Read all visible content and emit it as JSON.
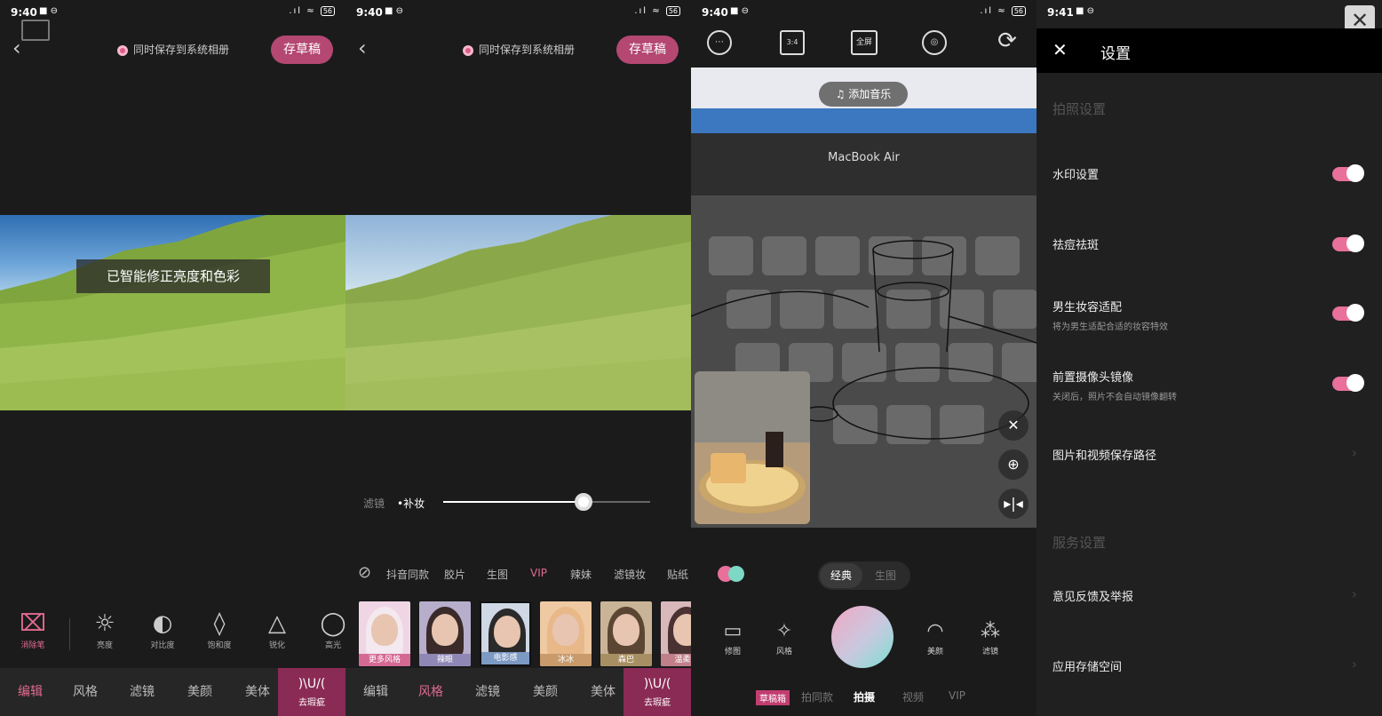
{
  "panel1": {
    "status": {
      "time": "9:40",
      "battery": "56"
    },
    "save_system": "同时保存到系统相册",
    "draft_button": "存草稿",
    "toast": "已智能修正亮度和色彩",
    "tools": [
      {
        "icon": "eraser-icon",
        "glyph": "⌧",
        "label": "消除笔",
        "active": true
      },
      {
        "icon": "brightness-icon",
        "glyph": "☼",
        "label": "亮度",
        "active": false
      },
      {
        "icon": "contrast-icon",
        "glyph": "◐",
        "label": "对比度",
        "active": false
      },
      {
        "icon": "saturation-icon",
        "glyph": "◊",
        "label": "饱和度",
        "active": false
      },
      {
        "icon": "sharpen-icon",
        "glyph": "△",
        "label": "锐化",
        "active": false
      },
      {
        "icon": "highlight-icon",
        "glyph": "◯",
        "label": "高光",
        "active": false
      }
    ],
    "tabs": [
      "编辑",
      "风格",
      "滤镜",
      "美颜",
      "美体"
    ],
    "tab_special": {
      "icon": ")\\U/(",
      "label": "去瑕疵"
    }
  },
  "panel2": {
    "status": {
      "time": "9:40",
      "battery": "56"
    },
    "save_system": "同时保存到系统相册",
    "draft_button": "存草稿",
    "filter_label": "滤镜",
    "filter_value": "•补妆",
    "slider_value": 0.68,
    "categories": [
      "抖音同款",
      "胶片",
      "生图",
      "VIP",
      "辣妹",
      "滤镜妆",
      "贴纸"
    ],
    "thumbs": [
      "更多风格",
      "辣眼",
      "电影感",
      "冰冰",
      "森巴",
      "温柔甜"
    ],
    "tabs": [
      "编辑",
      "风格",
      "滤镜",
      "美颜",
      "美体"
    ],
    "tab_special": {
      "icon": ")\\U/(",
      "label": "去瑕疵"
    }
  },
  "panel3": {
    "status": {
      "time": "9:40",
      "battery": "56"
    },
    "top_icons": [
      "⋯",
      "3:4",
      "全屏",
      "◎",
      "⟳"
    ],
    "music_button": "♫ 添加音乐",
    "laptop_label": "MacBook Air",
    "mode_classic": "经典",
    "mode_raw": "生图",
    "side_left": [
      {
        "label": "修图",
        "glyph": "▭"
      },
      {
        "label": "风格",
        "glyph": "✧"
      }
    ],
    "side_right": [
      {
        "label": "美颜",
        "glyph": "◠"
      },
      {
        "label": "滤镜",
        "glyph": "⁂"
      }
    ],
    "modes": [
      "草稿箱",
      "拍同款",
      "拍摄",
      "视频",
      "VIP"
    ],
    "current_mode": "拍摄"
  },
  "panel4": {
    "status": {
      "time": "9:41"
    },
    "title": "设置",
    "section_photo": "拍照设置",
    "rows": [
      {
        "title": "水印设置",
        "sub": "",
        "toggle": true
      },
      {
        "title": "祛痘祛斑",
        "sub": "",
        "toggle": true
      },
      {
        "title": "男生妆容适配",
        "sub": "将为男生适配合适的妆容特效",
        "toggle": true
      },
      {
        "title": "前置摄像头镜像",
        "sub": "关闭后，照片不会自动镜像翻转",
        "toggle": true
      },
      {
        "title": "图片和视频保存路径",
        "sub": "",
        "toggle": false
      }
    ],
    "section_service": "服务设置",
    "service_rows": [
      "意见反馈及举报",
      "应用存储空间"
    ]
  },
  "colors": {
    "accent": "#e06b90",
    "draft_bg": "#b44872",
    "tab_highlight": "#8a2b55"
  }
}
